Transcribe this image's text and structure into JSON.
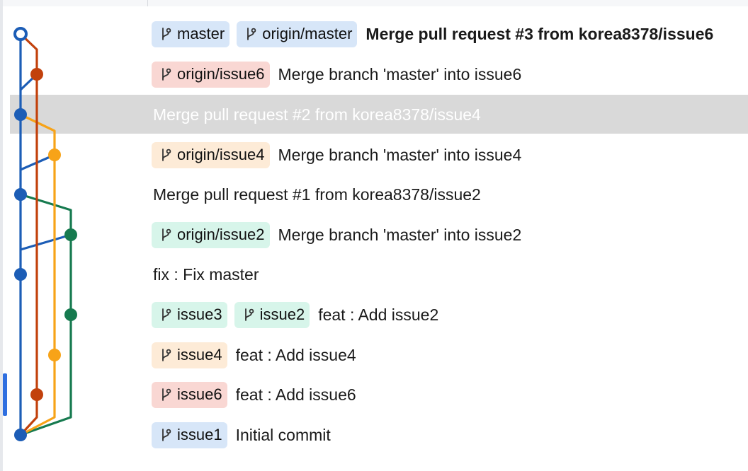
{
  "colors": {
    "lane_blue": "#1c5db6",
    "lane_red": "#c2410c",
    "lane_orange": "#f7a318",
    "lane_green": "#167a4f",
    "selection": "#d9d9d9"
  },
  "commits": [
    {
      "refs": [
        {
          "label": "master",
          "color": "blue"
        },
        {
          "label": "origin/master",
          "color": "blue"
        }
      ],
      "subject": "Merge pull request #3 from korea8378/issue6",
      "bold": true,
      "selected": false
    },
    {
      "refs": [
        {
          "label": "origin/issue6",
          "color": "red"
        }
      ],
      "subject": "Merge branch 'master' into issue6",
      "bold": false,
      "selected": false
    },
    {
      "refs": [],
      "subject": "Merge pull request #2 from korea8378/issue4",
      "bold": false,
      "selected": true
    },
    {
      "refs": [
        {
          "label": "origin/issue4",
          "color": "orange"
        }
      ],
      "subject": "Merge branch 'master' into issue4",
      "bold": false,
      "selected": false
    },
    {
      "refs": [],
      "subject": "Merge pull request #1 from korea8378/issue2",
      "bold": false,
      "selected": false
    },
    {
      "refs": [
        {
          "label": "origin/issue2",
          "color": "green"
        }
      ],
      "subject": "Merge branch 'master' into issue2",
      "bold": false,
      "selected": false
    },
    {
      "refs": [],
      "subject": "fix : Fix master",
      "bold": false,
      "selected": false
    },
    {
      "refs": [
        {
          "label": "issue3",
          "color": "green"
        },
        {
          "label": "issue2",
          "color": "green"
        }
      ],
      "subject": "feat : Add issue2",
      "bold": false,
      "selected": false
    },
    {
      "refs": [
        {
          "label": "issue4",
          "color": "orange"
        }
      ],
      "subject": "feat : Add issue4",
      "bold": false,
      "selected": false
    },
    {
      "refs": [
        {
          "label": "issue6",
          "color": "red"
        }
      ],
      "subject": "feat : Add issue6",
      "bold": false,
      "selected": false
    },
    {
      "refs": [
        {
          "label": "issue1",
          "color": "blue"
        }
      ],
      "subject": "Initial commit",
      "bold": false,
      "selected": false
    }
  ]
}
